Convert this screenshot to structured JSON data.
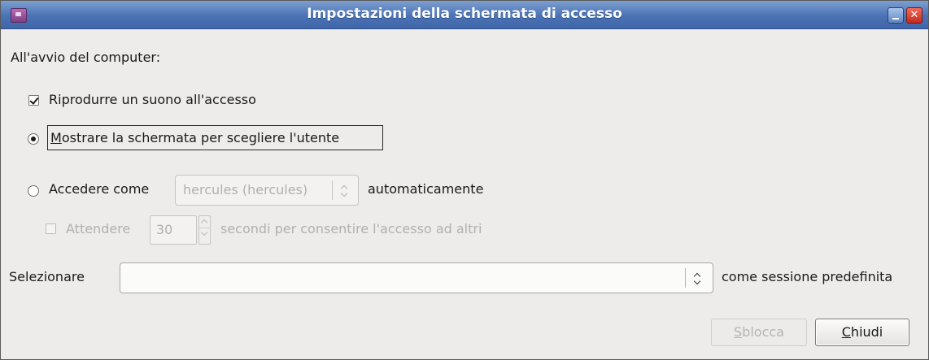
{
  "window": {
    "title": "Impostazioni della schermata di accesso",
    "titlebar_color": "#4a72b5"
  },
  "section_label": "All'avvio del computer:",
  "play_sound": {
    "label": "Riprodurre un suono all'accesso",
    "checked": true
  },
  "show_user_chooser": {
    "label": "Mostrare la schermata per scegliere l'utente",
    "selected": true
  },
  "auto_login": {
    "label": "Accedere come",
    "selected": false,
    "user_value": "hercules (hercules)",
    "suffix": "automaticamente"
  },
  "wait": {
    "label": "Attendere",
    "checked": false,
    "value": "30",
    "suffix": "secondi per consentire l'accesso ad altri"
  },
  "session": {
    "label": "Selezionare",
    "value": "",
    "suffix": "come sessione predefinita"
  },
  "buttons": {
    "unlock_first": "S",
    "unlock_rest": "blocca",
    "close_first": "C",
    "close_rest": "hiudi"
  },
  "icons": {
    "app": "login-screen-icon",
    "minimize": "minimize-icon",
    "close": "close-icon"
  }
}
